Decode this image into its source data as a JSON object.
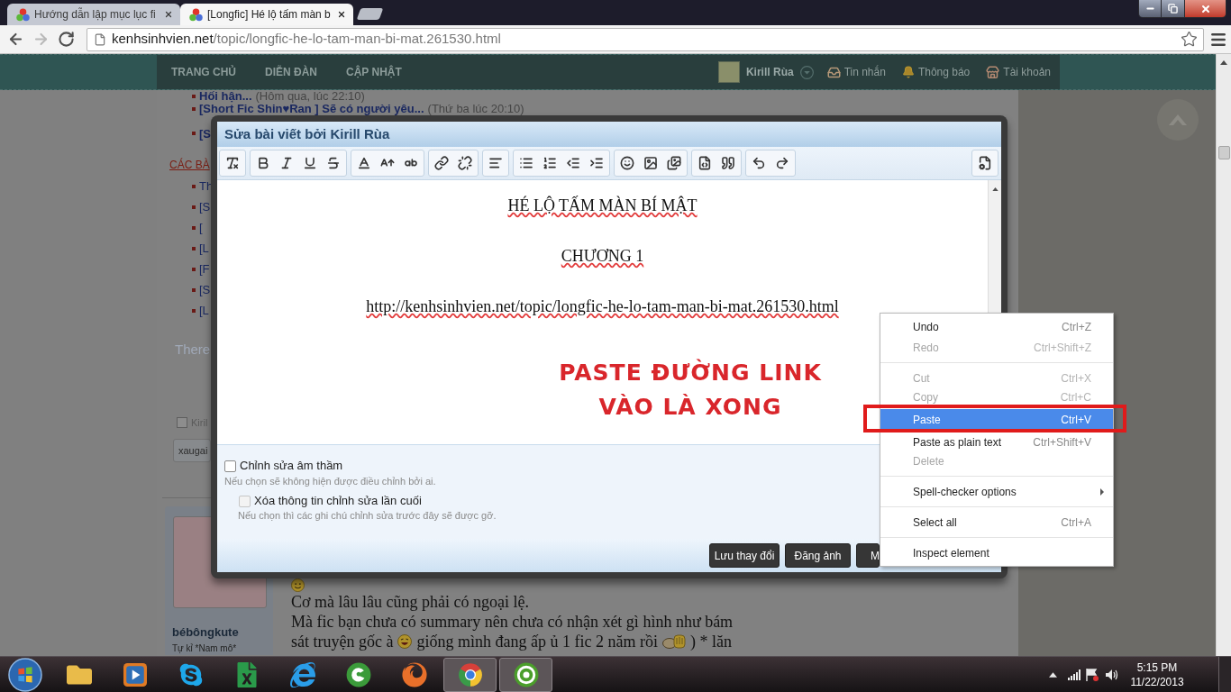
{
  "browser": {
    "tabs": [
      {
        "title": "Hướng dẫn lập mục lục fi",
        "selected": false
      },
      {
        "title": "[Longfic] Hé lộ tấm màn b",
        "selected": true
      }
    ],
    "nav_buttons": [
      {
        "kind": "back",
        "disabled": false
      },
      {
        "kind": "forward",
        "disabled": true
      },
      {
        "kind": "reload",
        "disabled": false
      }
    ],
    "address": {
      "host": "kenhsinhvien.net",
      "path": "/topic/longfic-he-lo-tam-man-bi-mat.261530.html"
    }
  },
  "site_nav": {
    "menu": [
      "TRANG CHỦ",
      "DIỄN ĐÀN",
      "CẬP NHẬT"
    ],
    "user": "Kirill Rùa",
    "links": [
      {
        "kind": "inbox",
        "label": "Tin nhắn"
      },
      {
        "kind": "bell",
        "label": "Thông báo"
      },
      {
        "kind": "account",
        "label": "Tài khoản"
      }
    ]
  },
  "background_page": {
    "recent_threads": [
      {
        "title": "Hối hận...",
        "time": "(Hôm qua, lúc 22:10)"
      },
      {
        "title": "[Short Fic Shin♥Ran ] Sẽ có người yêu...",
        "time": "(Thứ ba lúc 20:10)"
      },
      {
        "title": "[S"
      }
    ],
    "section_heading": "CÁC BÀ",
    "section_items": [
      "Th",
      "[S",
      "[",
      "[L",
      "[F",
      "[S",
      "[L"
    ],
    "notice": "There",
    "follow_option": {
      "label": "Kiril",
      "checked": false
    },
    "tag_field": "xaugai",
    "post": {
      "author": "bébôngkute",
      "user_title": "Tự kỉ *Nam mô*",
      "lines": [
        "Cơ mà lâu lâu cũng phải có ngoại lệ.",
        "Mà fic bạn chưa có summary nên chưa có nhận xét gì hình như bám"
      ],
      "last_line_parts": [
        "sát truyện gốc à",
        "giống mình đang ấp ủ 1 fic 2 năm rồi",
        ") * lăn"
      ]
    }
  },
  "dialog": {
    "title": "Sửa bài viết bởi Kirill Rùa",
    "content": [
      "HÉ LỘ TẤM MÀN BÍ MẬT",
      "CHƯƠNG 1",
      "http://kenhsinhvien.net/topic/longfic-he-lo-tam-man-bi-mat.261530.html"
    ],
    "options": [
      {
        "label": "Chỉnh sửa âm thầm",
        "hint": "Nếu chọn sẽ không hiện được điều chỉnh bởi ai.",
        "checked": false,
        "disabled": false,
        "children": [
          {
            "label": "Xóa thông tin chỉnh sửa lần cuối",
            "hint": "Nếu chọn thì các ghi chú chỉnh sửa trước đây sẽ được gỡ.",
            "checked": false,
            "disabled": true
          }
        ]
      }
    ],
    "buttons": [
      "Lưu thay đổi",
      "Đăng ảnh",
      "M"
    ]
  },
  "annotation": {
    "lines": [
      "PASTE ĐƯỜNG LINK",
      "VÀO LÀ XONG"
    ]
  },
  "context_menu": {
    "items": [
      {
        "kind": "item",
        "label": "Undo",
        "shortcut": "Ctrl+Z",
        "disabled": false,
        "selected": false,
        "submenu": false
      },
      {
        "kind": "item",
        "label": "Redo",
        "shortcut": "Ctrl+Shift+Z",
        "disabled": true,
        "selected": false,
        "submenu": false
      },
      {
        "kind": "separator"
      },
      {
        "kind": "item",
        "label": "Cut",
        "shortcut": "Ctrl+X",
        "disabled": true,
        "selected": false,
        "submenu": false
      },
      {
        "kind": "item",
        "label": "Copy",
        "shortcut": "Ctrl+C",
        "disabled": true,
        "selected": false,
        "submenu": false
      },
      {
        "kind": "item",
        "label": "Paste",
        "shortcut": "Ctrl+V",
        "disabled": false,
        "selected": true,
        "submenu": false
      },
      {
        "kind": "item",
        "label": "Paste as plain text",
        "shortcut": "Ctrl+Shift+V",
        "disabled": false,
        "selected": false,
        "submenu": false
      },
      {
        "kind": "item",
        "label": "Delete",
        "disabled": true,
        "selected": false,
        "submenu": false
      },
      {
        "kind": "separator"
      },
      {
        "kind": "item",
        "label": "Spell-checker options",
        "disabled": false,
        "selected": false,
        "submenu": true
      },
      {
        "kind": "separator"
      },
      {
        "kind": "item",
        "label": "Select all",
        "shortcut": "Ctrl+A",
        "disabled": false,
        "selected": false,
        "submenu": false
      },
      {
        "kind": "separator"
      },
      {
        "kind": "item",
        "label": "Inspect element",
        "disabled": false,
        "selected": false,
        "submenu": false
      }
    ]
  },
  "taskbar": {
    "apps": [
      {
        "kind": "folder",
        "active": false
      },
      {
        "kind": "media",
        "active": false
      },
      {
        "kind": "skype",
        "active": false
      },
      {
        "kind": "excel",
        "active": false
      },
      {
        "kind": "ie",
        "active": false
      },
      {
        "kind": "coccoc",
        "active": false
      },
      {
        "kind": "firefox",
        "active": false
      },
      {
        "kind": "chrome",
        "active": true
      },
      {
        "kind": "utorrent",
        "active": true
      }
    ],
    "clock": {
      "time": "5:15 PM",
      "date": "11/22/2013"
    }
  }
}
